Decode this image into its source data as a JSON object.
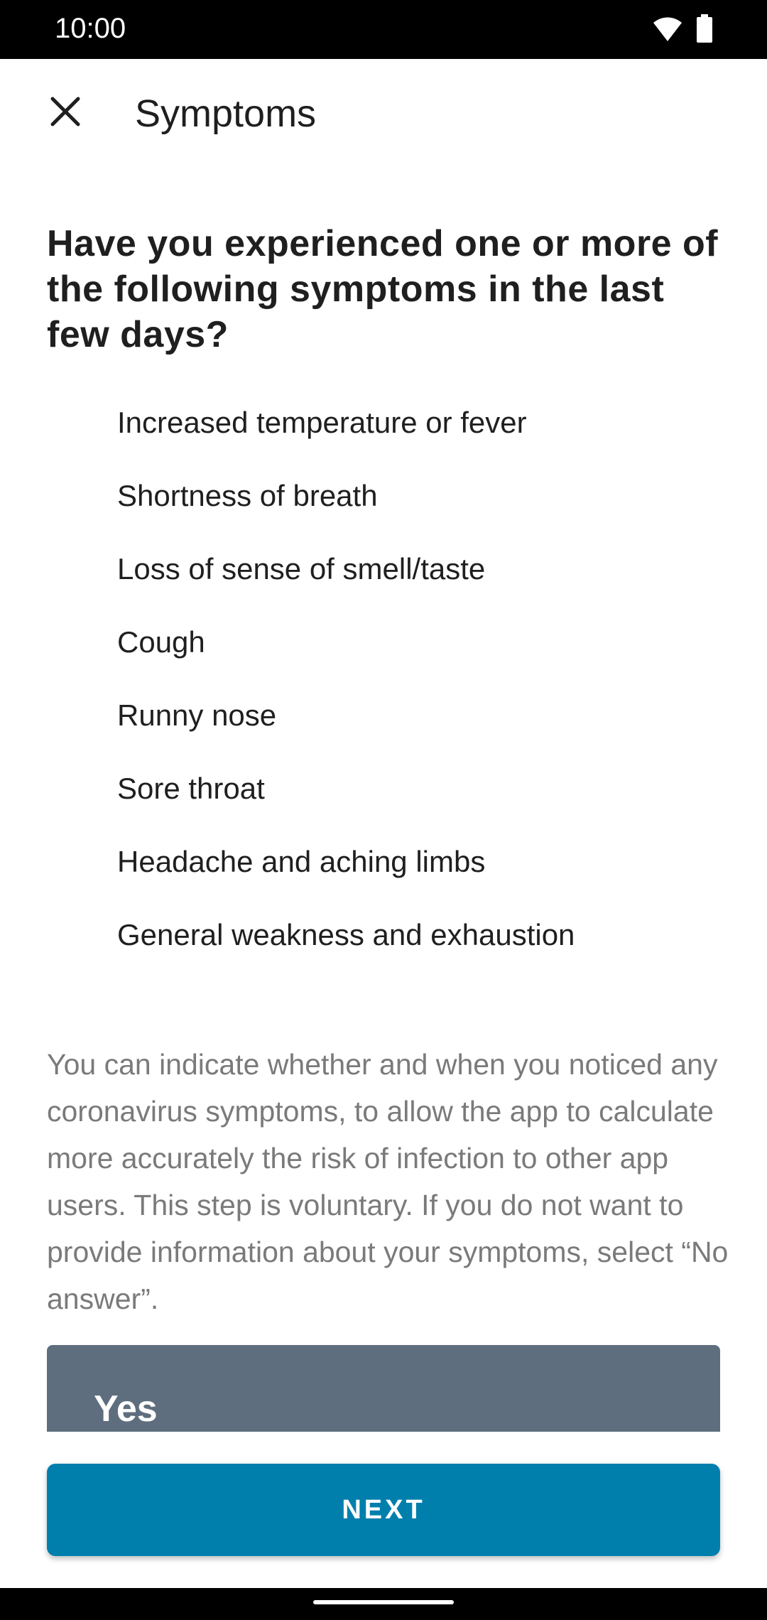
{
  "status_bar": {
    "time": "10:00",
    "icons": [
      "wifi-icon",
      "battery-icon"
    ]
  },
  "app_bar": {
    "title": "Symptoms",
    "close_icon": "close-icon"
  },
  "question": "Have you experienced one or more of the following symptoms in the last few days?",
  "symptoms": [
    "Increased temperature or fever",
    "Shortness of breath",
    "Loss of sense of smell/taste",
    "Cough",
    "Runny nose",
    "Sore throat",
    "Headache and aching limbs",
    "General weakness and exhaustion"
  ],
  "info_text": "You can indicate whether and when you noticed any coronavirus symptoms, to allow the app to calculate more accurately the risk of infection to other app users. This step is voluntary. If you do not want to provide information about your symptoms, select “No answer”.",
  "options": {
    "yes_label": "Yes"
  },
  "next_button": {
    "label": "NEXT"
  },
  "colors": {
    "accent": "#007fad",
    "option_bg": "#5e6e7e",
    "info_text": "#7a7a7a"
  }
}
